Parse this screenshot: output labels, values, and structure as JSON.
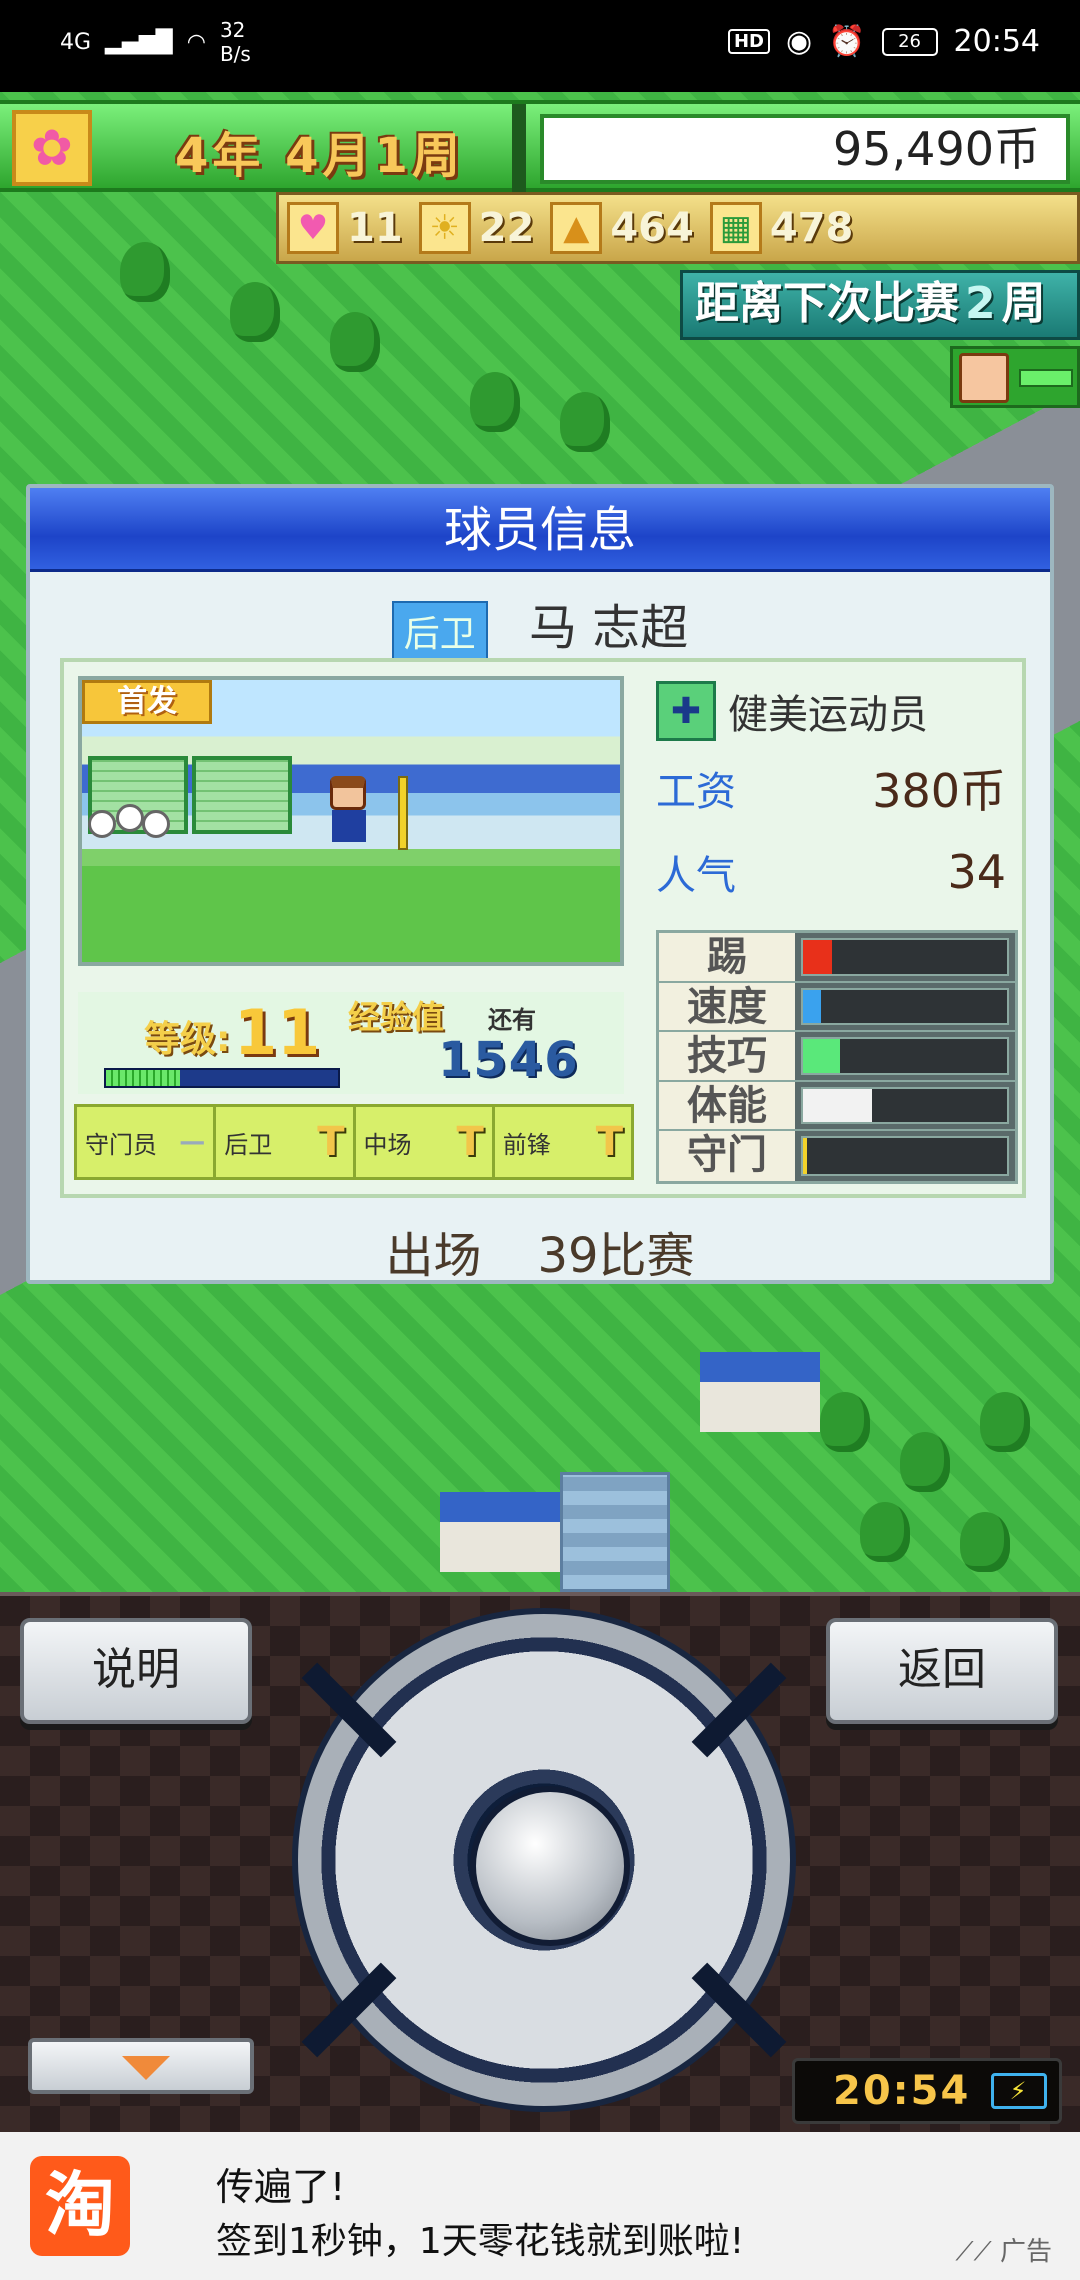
{
  "status_bar": {
    "network": "4G",
    "speed_value": "32",
    "speed_unit": "B/s",
    "hd": "HD",
    "battery": "26",
    "time": "20:54"
  },
  "hud": {
    "year": "4",
    "year_unit": "年",
    "month": "4月",
    "week_num": "1",
    "week_unit": "周",
    "money": "95,490币",
    "stats": [
      {
        "icon": "heart-icon",
        "value": "11"
      },
      {
        "icon": "bulb-icon",
        "value": "22"
      },
      {
        "icon": "pyramid-icon",
        "value": "464"
      },
      {
        "icon": "field-icon",
        "value": "478"
      }
    ],
    "next_match_prefix": "距离下次比赛",
    "next_match_weeks": "2",
    "next_match_suffix": "周"
  },
  "panel": {
    "title": "球员信息",
    "position_badge": "后卫",
    "player_name": "马 志超",
    "starter_label": "首发",
    "job": "健美运动员",
    "salary_label": "工资",
    "salary_value": "380币",
    "popularity_label": "人气",
    "popularity_value": "34",
    "level_label": "等级:",
    "level_value": "11",
    "exp_label": "经验值",
    "exp_sub": "还有",
    "exp_value": "1546",
    "level_progress": 0.32,
    "positions": [
      {
        "label": "守门员",
        "mark": "—"
      },
      {
        "label": "后卫",
        "mark": "T"
      },
      {
        "label": "中场",
        "mark": "T"
      },
      {
        "label": "前锋",
        "mark": "T"
      }
    ],
    "attributes": [
      {
        "label": "踢",
        "value": 0.14,
        "color": "#e8301a"
      },
      {
        "label": "速度",
        "value": 0.09,
        "color": "#3aa2ee"
      },
      {
        "label": "技巧",
        "value": 0.18,
        "color": "#5ae87a"
      },
      {
        "label": "体能",
        "value": 0.34,
        "color": "#f2f2f2"
      },
      {
        "label": "守门",
        "value": 0.02,
        "color": "#f2d22a"
      }
    ],
    "appearances_label": "出场",
    "appearances_value": "39比赛"
  },
  "controls": {
    "help_label": "说明",
    "back_label": "返回",
    "clock": "20:54",
    "clock_battery": "⚡"
  },
  "ad": {
    "logo": "淘",
    "title": "传遍了!",
    "subtitle": "签到1秒钟，1天零花钱就到账啦!",
    "tag": "广告"
  }
}
